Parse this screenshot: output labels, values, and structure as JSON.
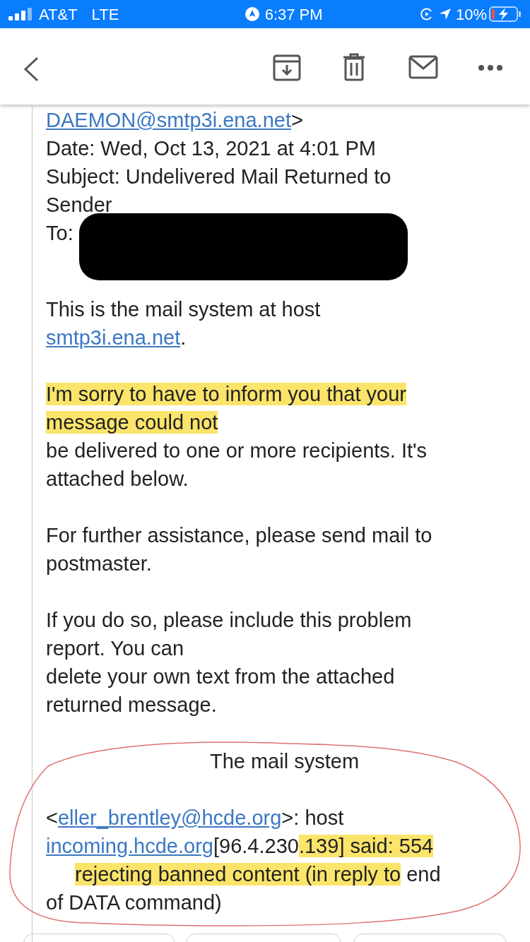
{
  "status_bar": {
    "carrier": "AT&T",
    "network": "LTE",
    "time": "6:37 PM",
    "battery": "10%",
    "charging": true
  },
  "header_lines": [
    [
      {
        "text": "DAEMON@smtp3i.ena.net",
        "kind": "link",
        "highlighted": false
      },
      {
        "text": ">",
        "kind": "text",
        "highlighted": false
      }
    ],
    [
      {
        "text": "Date: Wed, Oct 13, 2021 at 4:01 PM",
        "kind": "text",
        "highlighted": false
      }
    ],
    [
      {
        "text": "Subject: Undelivered Mail Returned to",
        "kind": "text",
        "highlighted": false
      }
    ],
    [
      {
        "text": "Sender",
        "kind": "text",
        "highlighted": false
      }
    ],
    [
      {
        "text": "To: ",
        "kind": "text",
        "highlighted": false
      },
      {
        "kind": "redacted"
      }
    ]
  ],
  "paragraphs": [
    {
      "kind": "plain",
      "lines": [
        {
          "indented": false,
          "segments": [
            {
              "text": "This is the mail system at host",
              "kind": "text",
              "highlighted": false
            }
          ]
        },
        {
          "indented": false,
          "segments": [
            {
              "text": "smtp3i.ena.net",
              "kind": "link",
              "highlighted": false
            },
            {
              "text": ".",
              "kind": "text",
              "highlighted": false
            }
          ]
        }
      ]
    },
    {
      "kind": "plain",
      "lines": [
        {
          "indented": false,
          "segments": [
            {
              "text": "I'm sorry to have to inform you that your",
              "kind": "text",
              "highlighted": true
            }
          ]
        },
        {
          "indented": false,
          "segments": [
            {
              "text": "message could not",
              "kind": "text",
              "highlighted": true
            }
          ]
        },
        {
          "indented": false,
          "segments": [
            {
              "text": "be delivered to one or more recipients. It's",
              "kind": "text",
              "highlighted": false
            }
          ]
        },
        {
          "indented": false,
          "segments": [
            {
              "text": "attached below.",
              "kind": "text",
              "highlighted": false
            }
          ]
        }
      ]
    },
    {
      "kind": "plain",
      "lines": [
        {
          "indented": false,
          "segments": [
            {
              "text": "For further assistance, please send mail to",
              "kind": "text",
              "highlighted": false
            }
          ]
        },
        {
          "indented": false,
          "segments": [
            {
              "text": "postmaster.",
              "kind": "text",
              "highlighted": false
            }
          ]
        }
      ]
    },
    {
      "kind": "plain",
      "lines": [
        {
          "indented": false,
          "segments": [
            {
              "text": "If you do so, please include this problem",
              "kind": "text",
              "highlighted": false
            }
          ]
        },
        {
          "indented": false,
          "segments": [
            {
              "text": "report. You can",
              "kind": "text",
              "highlighted": false
            }
          ]
        },
        {
          "indented": false,
          "segments": [
            {
              "text": "delete your own text from the attached",
              "kind": "text",
              "highlighted": false
            }
          ]
        },
        {
          "indented": false,
          "segments": [
            {
              "text": "returned message.",
              "kind": "text",
              "highlighted": false
            }
          ]
        }
      ]
    },
    {
      "kind": "centered",
      "lines": [
        {
          "indented": false,
          "segments": [
            {
              "text": "The mail system",
              "kind": "text",
              "highlighted": false
            }
          ]
        }
      ]
    },
    {
      "kind": "plain",
      "lines": [
        {
          "indented": false,
          "segments": [
            {
              "text": "<",
              "kind": "text",
              "highlighted": false
            },
            {
              "text": "eller_brentley@hcde.org",
              "kind": "link",
              "highlighted": false
            },
            {
              "text": ">: host",
              "kind": "text",
              "highlighted": false
            }
          ]
        },
        {
          "indented": false,
          "segments": [
            {
              "text": "incoming.hcde.org",
              "kind": "link",
              "highlighted": false
            },
            {
              "text": "[96.4.230",
              "kind": "text",
              "highlighted": false
            },
            {
              "text": ".139] said: 554",
              "kind": "text",
              "highlighted": true
            }
          ]
        },
        {
          "indented": true,
          "segments": [
            {
              "text": "rejecting banned content (in reply to",
              "kind": "text",
              "highlighted": true
            },
            {
              "text": " end",
              "kind": "text",
              "highlighted": false
            }
          ]
        },
        {
          "indented": false,
          "segments": [
            {
              "text": "of DATA command)",
              "kind": "text",
              "highlighted": false
            }
          ]
        }
      ]
    }
  ]
}
